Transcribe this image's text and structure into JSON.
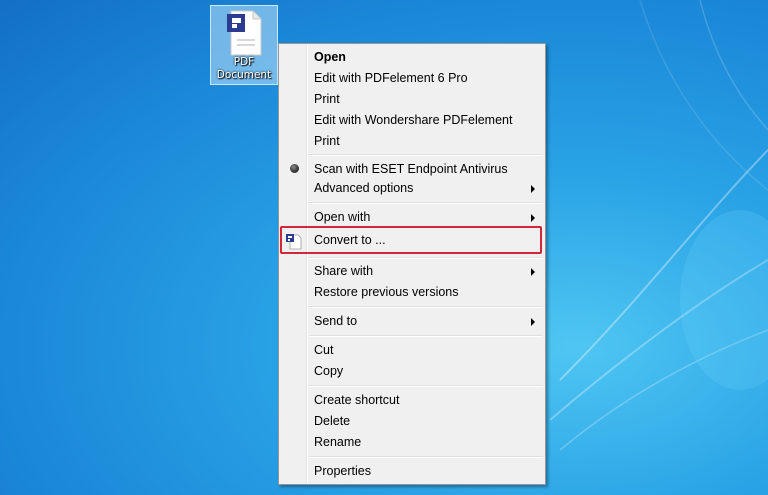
{
  "desktop": {
    "icon": {
      "label": "PDF\nDocument",
      "icon_name": "pdf-document-icon"
    }
  },
  "colors": {
    "highlight": "#d0283a",
    "wallpaper": "#1b88d8",
    "pdf_brand": "#2c3b8f"
  },
  "menu": {
    "items": [
      {
        "label": "Open",
        "bold": true
      },
      {
        "label": "Edit with PDFelement 6 Pro"
      },
      {
        "label": "Print"
      },
      {
        "label": "Edit with Wondershare PDFelement"
      },
      {
        "label": "Print"
      },
      {
        "label": "Scan with ESET Endpoint Antivirus",
        "icon": "eset-radio-icon"
      },
      {
        "label": "Advanced options",
        "submenu": true
      },
      {
        "label": "Open with",
        "submenu": true
      },
      {
        "label": "Convert to ...",
        "icon": "pdfelement-convert-icon",
        "highlighted": true
      },
      {
        "label": "Share with",
        "submenu": true
      },
      {
        "label": "Restore previous versions"
      },
      {
        "label": "Send to",
        "submenu": true
      },
      {
        "label": "Cut"
      },
      {
        "label": "Copy"
      },
      {
        "label": "Create shortcut"
      },
      {
        "label": "Delete"
      },
      {
        "label": "Rename"
      },
      {
        "label": "Properties"
      }
    ]
  }
}
